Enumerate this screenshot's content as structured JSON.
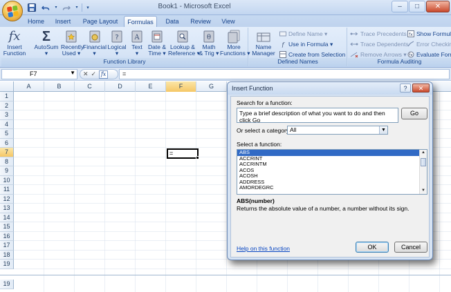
{
  "window": {
    "title": "Book1 - Microsoft Excel",
    "controls": [
      "–",
      "□",
      "✕"
    ]
  },
  "quick_access": {
    "save_icon": "save-icon",
    "undo_icon": "undo-icon",
    "redo_icon": "redo-icon"
  },
  "ribbon": {
    "tabs": [
      "Home",
      "Insert",
      "Page Layout",
      "Formulas",
      "Data",
      "Review",
      "View"
    ],
    "active_tab": "Formulas",
    "groups": {
      "function_library": {
        "label": "Function Library",
        "buttons": [
          {
            "line1": "Insert",
            "line2": "Function"
          },
          {
            "line1": "AutoSum",
            "line2": "▾"
          },
          {
            "line1": "Recently",
            "line2": "Used ▾"
          },
          {
            "line1": "Financial",
            "line2": "▾"
          },
          {
            "line1": "Logical",
            "line2": "▾"
          },
          {
            "line1": "Text",
            "line2": "▾"
          },
          {
            "line1": "Date &",
            "line2": "Time ▾"
          },
          {
            "line1": "Lookup &",
            "line2": "Reference ▾"
          },
          {
            "line1": "Math",
            "line2": "& Trig ▾"
          },
          {
            "line1": "More",
            "line2": "Functions ▾"
          }
        ]
      },
      "defined_names": {
        "label": "Defined Names",
        "name_manager": {
          "line1": "Name",
          "line2": "Manager"
        },
        "define_name": "Define Name ▾",
        "use_in_formula": "Use in Formula ▾",
        "create_from_selection": "Create from Selection"
      },
      "formula_auditing": {
        "label": "Formula Auditing",
        "trace_precedents": "Trace Precedents",
        "trace_dependents": "Trace Dependents",
        "remove_arrows": "Remove Arrows ▾",
        "show_formulas": "Show Formula",
        "error_checking": "Error Checkin",
        "evaluate_formula": "Evaluate Form"
      }
    }
  },
  "formula_bar": {
    "name_box": "F7",
    "cancel_glyph": "✕",
    "enter_glyph": "✓",
    "fx": "fx",
    "formula": "="
  },
  "sheet": {
    "columns": [
      "A",
      "B",
      "C",
      "D",
      "E",
      "F",
      "G"
    ],
    "selected_column": "F",
    "rows": [
      "1",
      "2",
      "3",
      "4",
      "5",
      "6",
      "7",
      "8",
      "9",
      "10",
      "11",
      "12",
      "13",
      "14",
      "15",
      "16",
      "17",
      "18",
      "19"
    ],
    "selected_row": "7",
    "bottom_row": "19",
    "active_cell": {
      "ref": "F7",
      "value": "="
    }
  },
  "dialog": {
    "title": "Insert Function",
    "help": "?",
    "close": "✕",
    "search_label": "Search for a function:",
    "search_text": "Type a brief description of what you want to do and then click Go",
    "go_label": "Go",
    "category_label": "Or select a category:",
    "category_value": "All",
    "select_label": "Select a function:",
    "functions": [
      "ABS",
      "ACCRINT",
      "ACCRINTM",
      "ACOS",
      "ACOSH",
      "ADDRESS",
      "AMORDEGRC"
    ],
    "selected_function": "ABS",
    "signature": "ABS(number)",
    "description": "Returns the absolute value of a number, a number without its sign.",
    "help_link": "Help on this function",
    "ok_label": "OK",
    "cancel_label": "Cancel"
  }
}
